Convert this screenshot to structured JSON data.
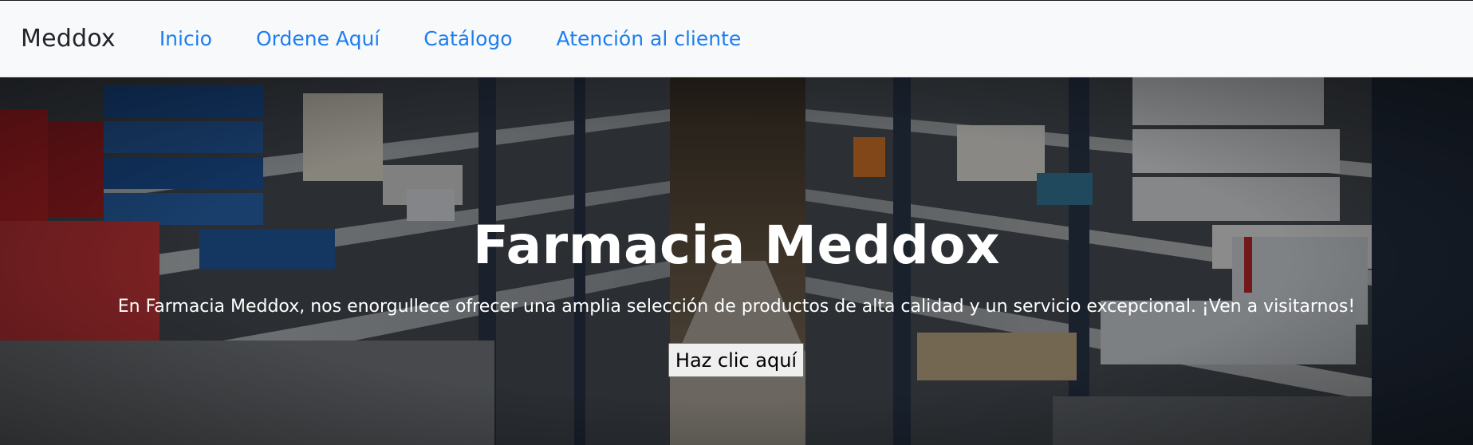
{
  "navbar": {
    "brand": "Meddox",
    "links": [
      {
        "label": "Inicio"
      },
      {
        "label": "Ordene Aquí"
      },
      {
        "label": "Catálogo"
      },
      {
        "label": "Atención al cliente"
      }
    ]
  },
  "hero": {
    "title": "Farmacia Meddox",
    "text": "En Farmacia Meddox, nos enorgullece ofrecer una amplia selección de productos de alta calidad y un servicio excepcional. ¡Ven a visitarnos!",
    "button_label": "Haz clic aquí",
    "background": "pharmacy-shelves-photo"
  },
  "colors": {
    "navbar_bg": "#f8f9fa",
    "link": "#1d7ef0",
    "brand": "#212529",
    "hero_text": "#ffffff"
  }
}
